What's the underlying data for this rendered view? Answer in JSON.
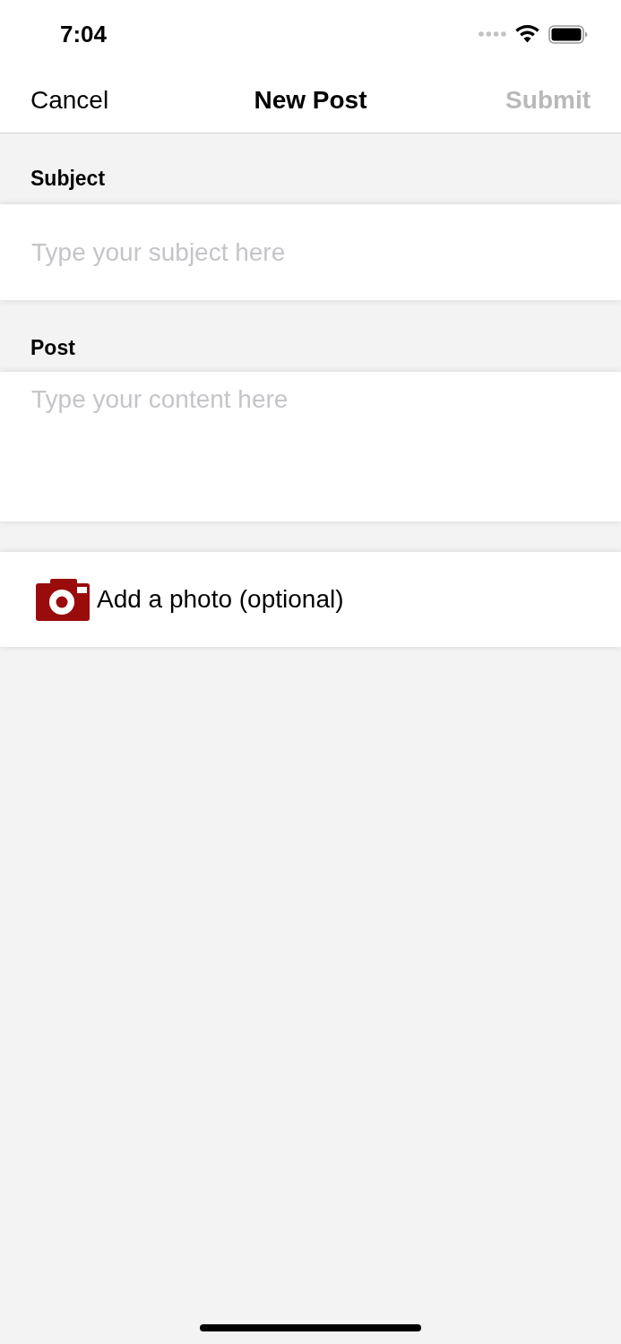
{
  "status_bar": {
    "time": "7:04"
  },
  "nav_bar": {
    "cancel": "Cancel",
    "title": "New Post",
    "submit": {
      "label": "Submit",
      "disabled": true
    }
  },
  "fields": [
    {
      "label": "Subject",
      "placeholder": "Type your subject here",
      "kind": "single"
    },
    {
      "label": "Post",
      "placeholder": "Type your content here",
      "kind": "multi"
    }
  ],
  "photo_button": {
    "label": "Add a photo (optional)"
  }
}
